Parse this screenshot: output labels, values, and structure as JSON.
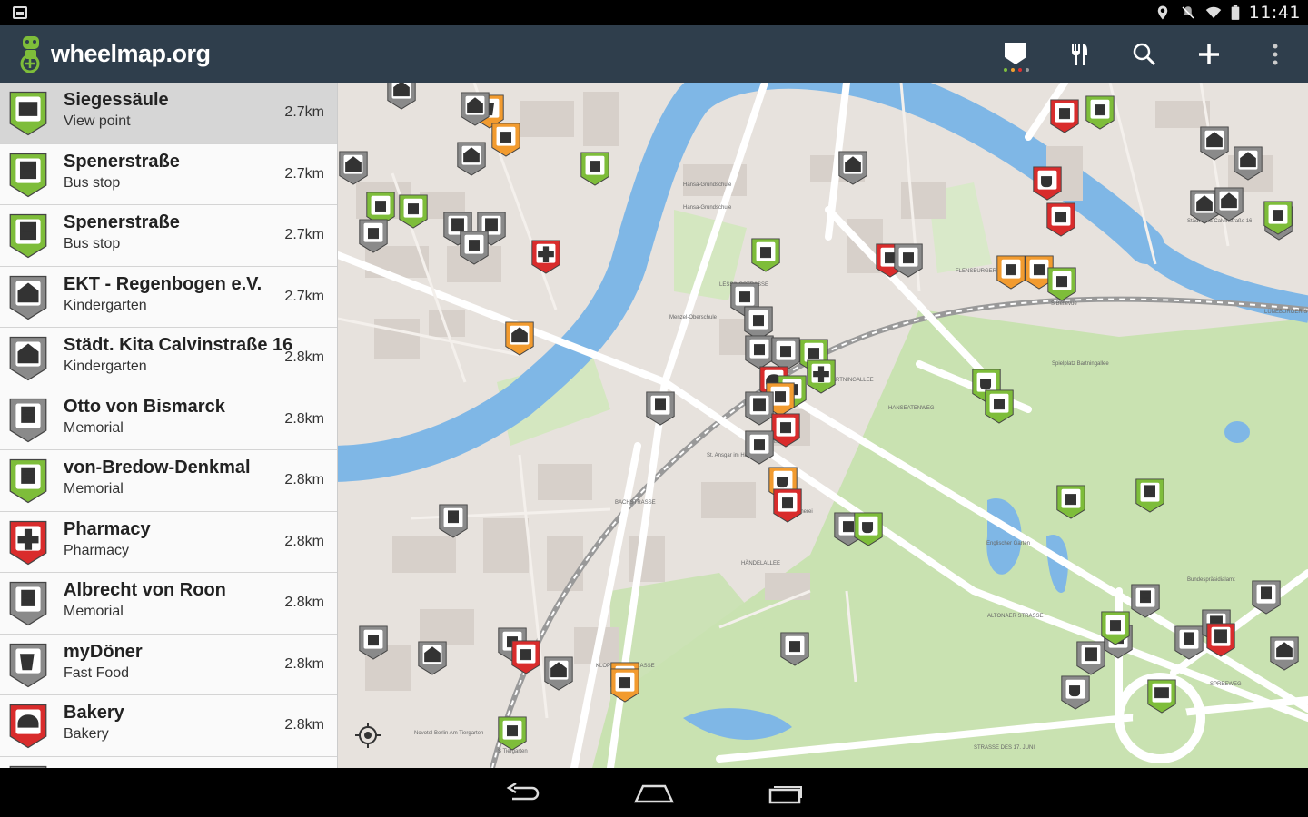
{
  "status_bar": {
    "time": "11:41",
    "icons": [
      "screenshot-icon",
      "location-icon",
      "mute-icon",
      "wifi-icon",
      "battery-icon"
    ]
  },
  "app": {
    "title": "wheelmap.org",
    "logo_icon": "wheelchair-logo-icon",
    "actions": [
      "filter-icon",
      "category-icon",
      "search-icon",
      "add-icon",
      "overflow-icon"
    ],
    "filter_dot_colors": [
      "#7fbf3f",
      "#f0a030",
      "#e03030",
      "#999999"
    ]
  },
  "colors": {
    "green": "#7ebd3a",
    "orange": "#f29b2f",
    "red": "#d92c2c",
    "grey": "#8a8a8a",
    "actionbar": "#2f3e4c",
    "water": "#7fb7e6",
    "park": "#c9e2b1"
  },
  "places": [
    {
      "name": "Siegessäule",
      "category": "View point",
      "distance": "2.7km",
      "status": "green",
      "icon": "viewpoint-icon",
      "selected": true
    },
    {
      "name": "Spenerstraße",
      "category": "Bus stop",
      "distance": "2.7km",
      "status": "green",
      "icon": "bus-icon"
    },
    {
      "name": "Spenerstraße",
      "category": "Bus stop",
      "distance": "2.7km",
      "status": "green",
      "icon": "bus-icon"
    },
    {
      "name": "EKT - Regenbogen e.V.",
      "category": "Kindergarten",
      "distance": "2.7km",
      "status": "grey",
      "icon": "kindergarten-icon"
    },
    {
      "name": "Städt. Kita Calvinstraße 16",
      "category": "Kindergarten",
      "distance": "2.8km",
      "status": "grey",
      "icon": "kindergarten-icon"
    },
    {
      "name": "Otto von Bismarck",
      "category": "Memorial",
      "distance": "2.8km",
      "status": "grey",
      "icon": "memorial-icon"
    },
    {
      "name": "von-Bredow-Denkmal",
      "category": "Memorial",
      "distance": "2.8km",
      "status": "green",
      "icon": "memorial-icon"
    },
    {
      "name": "Pharmacy",
      "category": "Pharmacy",
      "distance": "2.8km",
      "status": "red",
      "icon": "pharmacy-icon"
    },
    {
      "name": "Albrecht von Roon",
      "category": "Memorial",
      "distance": "2.8km",
      "status": "grey",
      "icon": "memorial-icon"
    },
    {
      "name": "myDöner",
      "category": "Fast Food",
      "distance": "2.8km",
      "status": "grey",
      "icon": "fastfood-icon"
    },
    {
      "name": "Bakery",
      "category": "Bakery",
      "distance": "2.8km",
      "status": "red",
      "icon": "bakery-icon"
    },
    {
      "name": "",
      "category": "",
      "distance": "",
      "status": "grey",
      "icon": "cafe-icon"
    }
  ],
  "map": {
    "labels": [
      "Hansa-Grundschule",
      "Hansa-Grundschule",
      "Menzel-Oberschule",
      "Spielplatz Bartningallee",
      "Englischer Garten",
      "Bundespräsidialamt",
      "St. Ansgar im Hansaviertel",
      "Hansa Bücherei",
      "Novotel Berlin Am Tiergarten",
      "S Bellevue",
      "S Tiergarten",
      "Städt. Kita Calvinstraße 16",
      "BARTNINGALLEE",
      "HANSEATENWEG",
      "ALTONAER STRASSE",
      "KLOPSTOCKSTRASSE",
      "BACHSTRASSE",
      "HÄNDELALLEE",
      "STRASSE DES 17. JUNI",
      "SPREEWEG",
      "FLENSBURGER STR.",
      "LESSINGSTRASSE",
      "LÜNEBURGER STRASSE",
      "Hansaplatz"
    ],
    "markers": [
      {
        "status": "grey",
        "icon": "kindergarten-icon"
      },
      {
        "status": "orange",
        "icon": "fastfood-icon"
      },
      {
        "status": "grey",
        "icon": "kindergarten-icon"
      },
      {
        "status": "orange",
        "icon": "restaurant-icon"
      },
      {
        "status": "green",
        "icon": "restaurant-icon"
      },
      {
        "status": "grey",
        "icon": "kindergarten-icon"
      },
      {
        "status": "red",
        "icon": "restaurant-icon"
      },
      {
        "status": "green",
        "icon": "restaurant-icon"
      },
      {
        "status": "grey",
        "icon": "kindergarten-icon"
      },
      {
        "status": "grey",
        "icon": "kindergarten-icon"
      },
      {
        "status": "green",
        "icon": "fuel-icon"
      },
      {
        "status": "green",
        "icon": "shop-icon"
      },
      {
        "status": "grey",
        "icon": "building-icon"
      },
      {
        "status": "grey",
        "icon": "bus-icon"
      },
      {
        "status": "grey",
        "icon": "bus-icon"
      },
      {
        "status": "grey",
        "icon": "eye-icon"
      },
      {
        "status": "red",
        "icon": "pharmacy-icon"
      },
      {
        "status": "red",
        "icon": "cafe-icon"
      },
      {
        "status": "red",
        "icon": "music-icon"
      },
      {
        "status": "grey",
        "icon": "kindergarten-icon"
      },
      {
        "status": "grey",
        "icon": "memorial-icon"
      },
      {
        "status": "green",
        "icon": "bottle-icon"
      },
      {
        "status": "red",
        "icon": "bin-icon"
      },
      {
        "status": "grey",
        "icon": "scissors-icon"
      },
      {
        "status": "orange",
        "icon": "restaurant-icon"
      },
      {
        "status": "orange",
        "icon": "restaurant-icon"
      },
      {
        "status": "green",
        "icon": "train-icon"
      },
      {
        "status": "orange",
        "icon": "kindergarten-icon"
      },
      {
        "status": "grey",
        "icon": "fuel-icon"
      },
      {
        "status": "grey",
        "icon": "parking-icon"
      },
      {
        "status": "grey",
        "icon": "car-icon"
      },
      {
        "status": "grey",
        "icon": "parking-icon"
      },
      {
        "status": "green",
        "icon": "atm-icon"
      },
      {
        "status": "green",
        "icon": "pharmacy-icon"
      },
      {
        "status": "red",
        "icon": "bakery-icon"
      },
      {
        "status": "green",
        "icon": "shop-icon"
      },
      {
        "status": "orange",
        "icon": "restaurant-icon"
      },
      {
        "status": "grey",
        "icon": "bus-icon"
      },
      {
        "status": "red",
        "icon": "train-icon"
      },
      {
        "status": "grey",
        "icon": "parking-icon"
      },
      {
        "status": "grey",
        "icon": "memorial-icon"
      },
      {
        "status": "green",
        "icon": "cafe-icon"
      },
      {
        "status": "green",
        "icon": "theatre-icon"
      },
      {
        "status": "orange",
        "icon": "cafe-icon"
      },
      {
        "status": "red",
        "icon": "train-icon"
      },
      {
        "status": "grey",
        "icon": "nightclub-icon"
      },
      {
        "status": "green",
        "icon": "cafe-icon"
      },
      {
        "status": "green",
        "icon": "restaurant-icon"
      },
      {
        "status": "green",
        "icon": "memorial-icon"
      },
      {
        "status": "grey",
        "icon": "memorial-icon"
      },
      {
        "status": "grey",
        "icon": "memorial-icon"
      },
      {
        "status": "grey",
        "icon": "kindergarten-icon"
      },
      {
        "status": "grey",
        "icon": "kindergarten-icon"
      },
      {
        "status": "grey",
        "icon": "memorial-icon"
      },
      {
        "status": "grey",
        "icon": "kindergarten-icon"
      },
      {
        "status": "grey",
        "icon": "kindergarten-icon"
      },
      {
        "status": "grey",
        "icon": "bus-icon"
      },
      {
        "status": "grey",
        "icon": "memorial-icon"
      },
      {
        "status": "grey",
        "icon": "memorial-icon"
      },
      {
        "status": "grey",
        "icon": "bus-icon"
      },
      {
        "status": "red",
        "icon": "bus-icon"
      },
      {
        "status": "grey",
        "icon": "cafe-icon"
      },
      {
        "status": "green",
        "icon": "viewpoint-icon"
      },
      {
        "status": "grey",
        "icon": "sport-icon"
      },
      {
        "status": "orange",
        "icon": "cafe-icon"
      },
      {
        "status": "grey",
        "icon": "parking-icon"
      },
      {
        "status": "grey",
        "icon": "kindergarten-icon"
      },
      {
        "status": "grey",
        "icon": "dentist-icon"
      },
      {
        "status": "red",
        "icon": "restaurant-icon"
      },
      {
        "status": "grey",
        "icon": "kindergarten-icon"
      },
      {
        "status": "orange",
        "icon": "restaurant-icon"
      },
      {
        "status": "green",
        "icon": "train-icon"
      },
      {
        "status": "green",
        "icon": "shop-icon"
      },
      {
        "status": "green",
        "icon": "hotel-icon"
      }
    ]
  },
  "navigation": [
    "back-icon",
    "home-icon",
    "recents-icon"
  ]
}
